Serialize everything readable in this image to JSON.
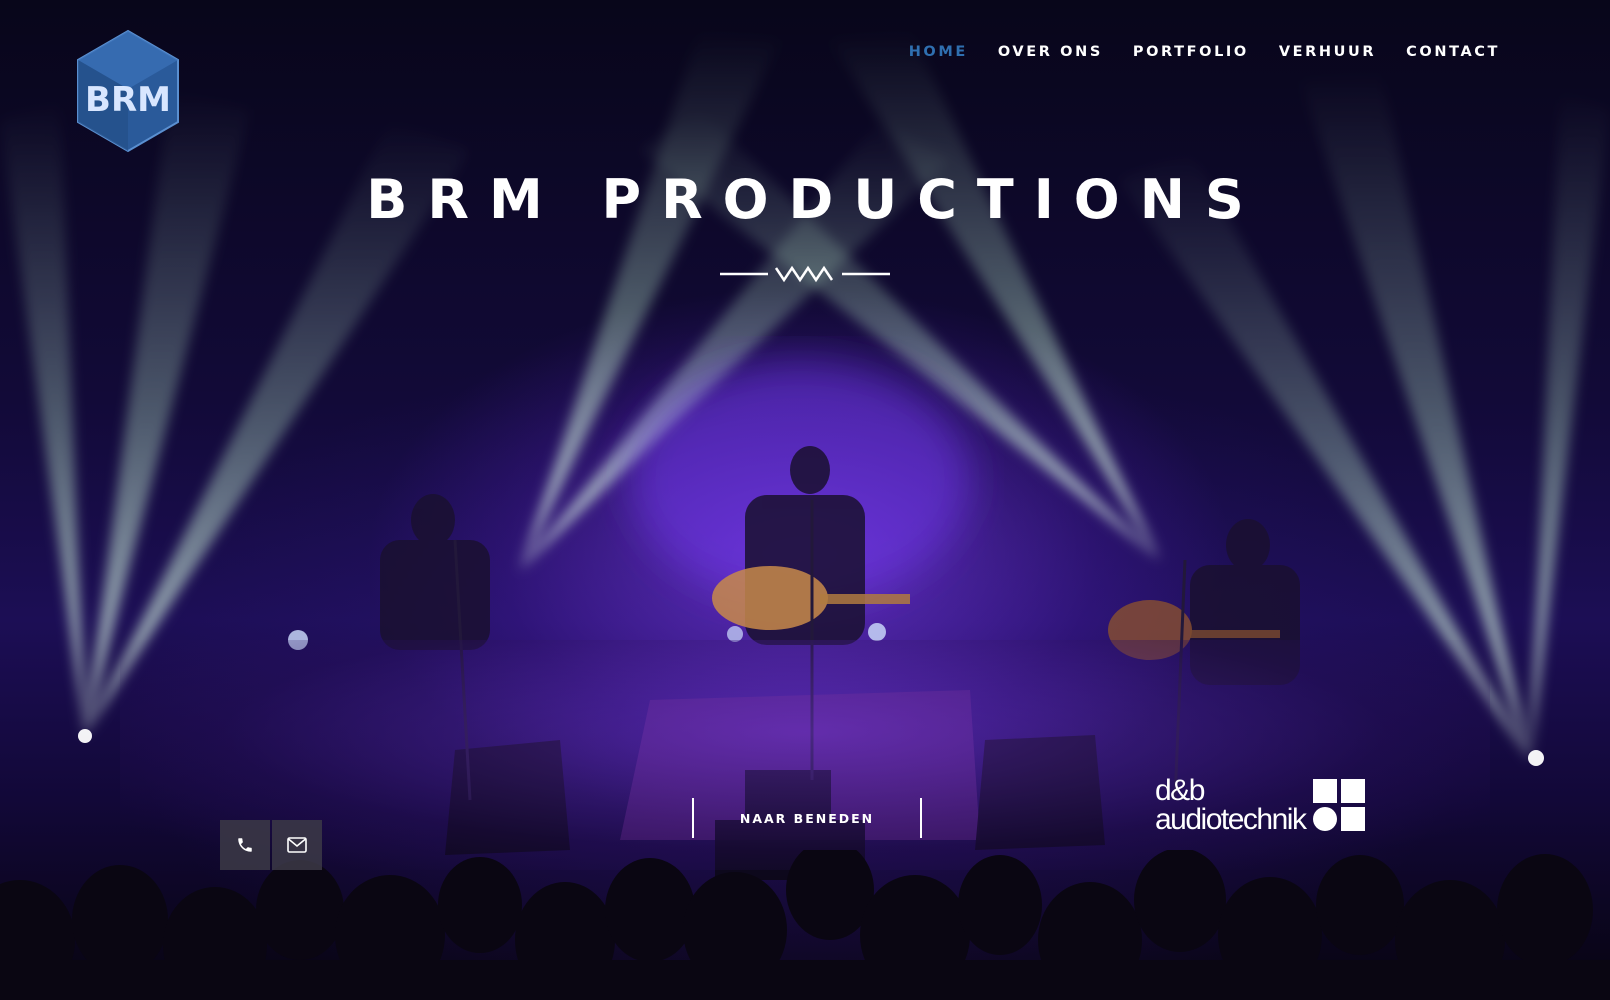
{
  "brand": {
    "logo_text": "BRM",
    "logo_colors": {
      "dark": "#2a5a9a",
      "light": "#5a8fd0"
    }
  },
  "nav": {
    "items": [
      {
        "label": "HOME",
        "active": true
      },
      {
        "label": "OVER ONS",
        "active": false
      },
      {
        "label": "PORTFOLIO",
        "active": false
      },
      {
        "label": "VERHUUR",
        "active": false
      },
      {
        "label": "CONTACT",
        "active": false
      }
    ],
    "active_color": "#2f6fb0",
    "text_color": "#ffffff"
  },
  "hero": {
    "title": "BRM PRODUCTIONS",
    "divider_icon": "zigzag-divider-icon",
    "scroll_button_label": "NAAR BENEDEN"
  },
  "contact_buttons": {
    "phone_icon": "phone-icon",
    "mail_icon": "envelope-icon"
  },
  "sponsor": {
    "line1": "d&b",
    "line2": "audiotechnik",
    "mark_icon": "db-squares-logo-icon"
  }
}
